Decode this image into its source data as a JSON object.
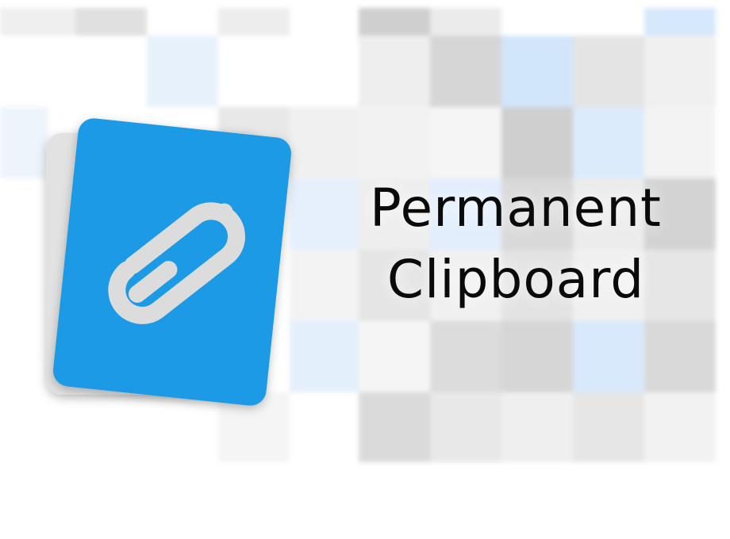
{
  "title": {
    "line1": "Permanent",
    "line2": "Clipboard"
  },
  "icons": {
    "logo": "paperclip-icon"
  },
  "colors": {
    "card_blue": "#1a9ae6",
    "card_back": "#e2e2e2",
    "clip": "#dcdcdc",
    "text": "#0a0a0a"
  }
}
